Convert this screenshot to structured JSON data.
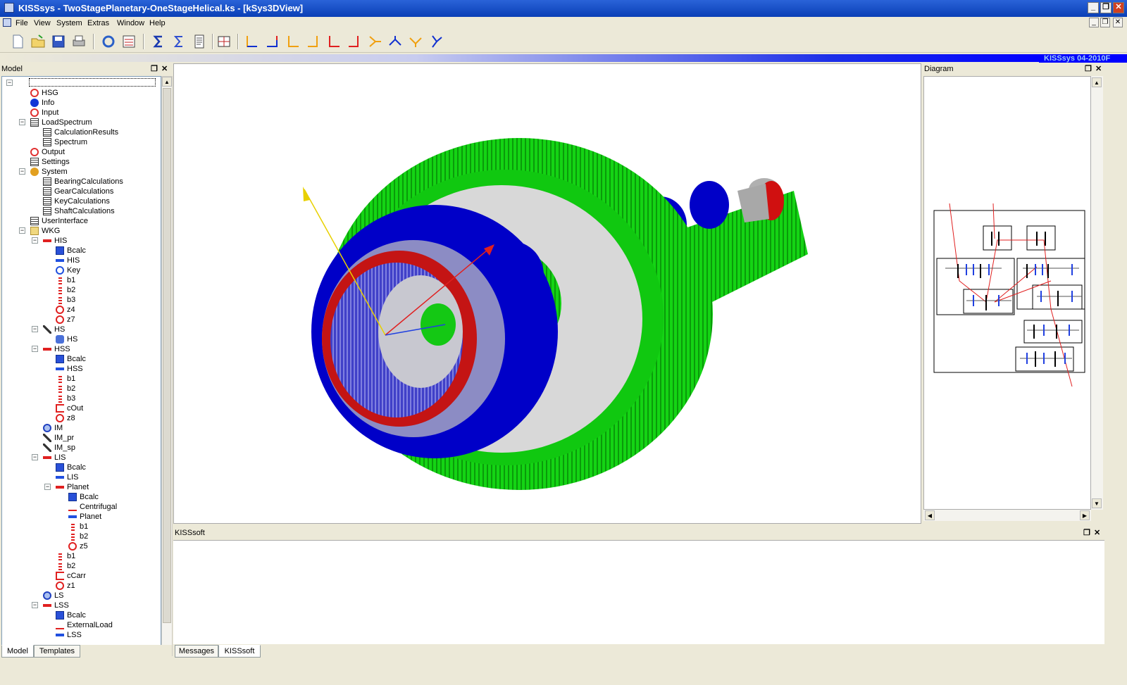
{
  "window": {
    "title": "KISSsys - TwoStagePlanetary-OneStageHelical.ks - [kSys3DView]",
    "minimize": "_",
    "restore": "❐",
    "close": "✕"
  },
  "menu": [
    "File",
    "View",
    "System",
    "Extras",
    "Window",
    "Help"
  ],
  "toolbar_icons": [
    "new-icon",
    "open-icon",
    "save-icon",
    "print-icon",
    "refresh-icon",
    "calculate-icon",
    "sigma-icon",
    "sum-icon",
    "report-icon",
    "structure-icon",
    "view-x-icon",
    "view-y-icon",
    "view-z-icon",
    "view-xy-icon",
    "view-yz-icon",
    "view-xz-icon",
    "view-iso1-icon",
    "view-iso2-icon",
    "view-iso3-icon",
    "view-iso4-icon"
  ],
  "version": "KISSsys 04-2010F",
  "model_panel": {
    "title": "Model",
    "tabs": [
      "Model",
      "Templates"
    ],
    "tree": [
      {
        "label": "",
        "icon": "root-icon",
        "level": 0,
        "exp": "−"
      },
      {
        "label": "HSG",
        "icon": "target",
        "level": 1
      },
      {
        "label": "Info",
        "icon": "info",
        "level": 1
      },
      {
        "label": "Input",
        "icon": "target",
        "level": 1
      },
      {
        "label": "LoadSpectrum",
        "icon": "table",
        "level": 1,
        "exp": "−"
      },
      {
        "label": "CalculationResults",
        "icon": "table",
        "level": 2
      },
      {
        "label": "Spectrum",
        "icon": "table",
        "level": 2
      },
      {
        "label": "Output",
        "icon": "target",
        "level": 1
      },
      {
        "label": "Settings",
        "icon": "table",
        "level": 1
      },
      {
        "label": "System",
        "icon": "gear",
        "level": 1,
        "exp": "−"
      },
      {
        "label": "BearingCalculations",
        "icon": "table",
        "level": 2
      },
      {
        "label": "GearCalculations",
        "icon": "table",
        "level": 2
      },
      {
        "label": "KeyCalculations",
        "icon": "table",
        "level": 2
      },
      {
        "label": "ShaftCalculations",
        "icon": "table",
        "level": 2
      },
      {
        "label": "UserInterface",
        "icon": "table",
        "level": 1
      },
      {
        "label": "WKG",
        "icon": "folder",
        "level": 1,
        "exp": "−"
      },
      {
        "label": "HIS",
        "icon": "shaftred",
        "level": 2,
        "exp": "−"
      },
      {
        "label": "Bcalc",
        "icon": "bcalc",
        "level": 3
      },
      {
        "label": "HIS",
        "icon": "shaftblue",
        "level": 3
      },
      {
        "label": "Key",
        "icon": "ring",
        "level": 3
      },
      {
        "label": "b1",
        "icon": "bearing",
        "level": 3
      },
      {
        "label": "b2",
        "icon": "bearing",
        "level": 3
      },
      {
        "label": "b3",
        "icon": "bearing",
        "level": 3
      },
      {
        "label": "z4",
        "icon": "gearz",
        "level": 3
      },
      {
        "label": "z7",
        "icon": "gearz",
        "level": 3
      },
      {
        "label": "HS",
        "icon": "wrench",
        "level": 2,
        "exp": "−"
      },
      {
        "label": "HS",
        "icon": "coupling",
        "level": 3
      },
      {
        "label": "HSS",
        "icon": "shaftred",
        "level": 2,
        "exp": "−"
      },
      {
        "label": "Bcalc",
        "icon": "bcalc",
        "level": 3
      },
      {
        "label": "HSS",
        "icon": "shaftblue",
        "level": 3
      },
      {
        "label": "b1",
        "icon": "bearing",
        "level": 3
      },
      {
        "label": "b2",
        "icon": "bearing",
        "level": 3
      },
      {
        "label": "b3",
        "icon": "bearing",
        "level": 3
      },
      {
        "label": "cOut",
        "icon": "clamp",
        "level": 3
      },
      {
        "label": "z8",
        "icon": "gearz",
        "level": 3
      },
      {
        "label": "IM",
        "icon": "globe",
        "level": 2
      },
      {
        "label": "IM_pr",
        "icon": "wrench",
        "level": 2
      },
      {
        "label": "IM_sp",
        "icon": "wrench",
        "level": 2
      },
      {
        "label": "LIS",
        "icon": "shaftred",
        "level": 2,
        "exp": "−"
      },
      {
        "label": "Bcalc",
        "icon": "bcalc",
        "level": 3
      },
      {
        "label": "LIS",
        "icon": "shaftblue",
        "level": 3
      },
      {
        "label": "Planet",
        "icon": "shaftred",
        "level": 3,
        "exp": "−"
      },
      {
        "label": "Bcalc",
        "icon": "bcalc",
        "level": 4
      },
      {
        "label": "Centrifugal",
        "icon": "arrow",
        "level": 4
      },
      {
        "label": "Planet",
        "icon": "shaftblue",
        "level": 4
      },
      {
        "label": "b1",
        "icon": "bearing",
        "level": 4
      },
      {
        "label": "b2",
        "icon": "bearing",
        "level": 4
      },
      {
        "label": "z5",
        "icon": "gearz",
        "level": 4
      },
      {
        "label": "b1",
        "icon": "bearing",
        "level": 3
      },
      {
        "label": "b2",
        "icon": "bearing",
        "level": 3
      },
      {
        "label": "cCarr",
        "icon": "clamp",
        "level": 3
      },
      {
        "label": "z1",
        "icon": "gearz",
        "level": 3
      },
      {
        "label": "LS",
        "icon": "globe",
        "level": 2
      },
      {
        "label": "LSS",
        "icon": "shaftred",
        "level": 2,
        "exp": "−"
      },
      {
        "label": "Bcalc",
        "icon": "bcalc",
        "level": 3
      },
      {
        "label": "ExternalLoad",
        "icon": "arrow",
        "level": 3
      },
      {
        "label": "LSS",
        "icon": "shaftblue",
        "level": 3
      }
    ]
  },
  "diagram_panel": {
    "title": "Diagram"
  },
  "kiss_panel": {
    "title": "KISSsoft",
    "tabs": [
      "Messages",
      "KISSsoft"
    ]
  },
  "colors": {
    "green": "#10c810",
    "blue": "#0000c8",
    "red": "#d01010",
    "accent": "#0000ff"
  }
}
